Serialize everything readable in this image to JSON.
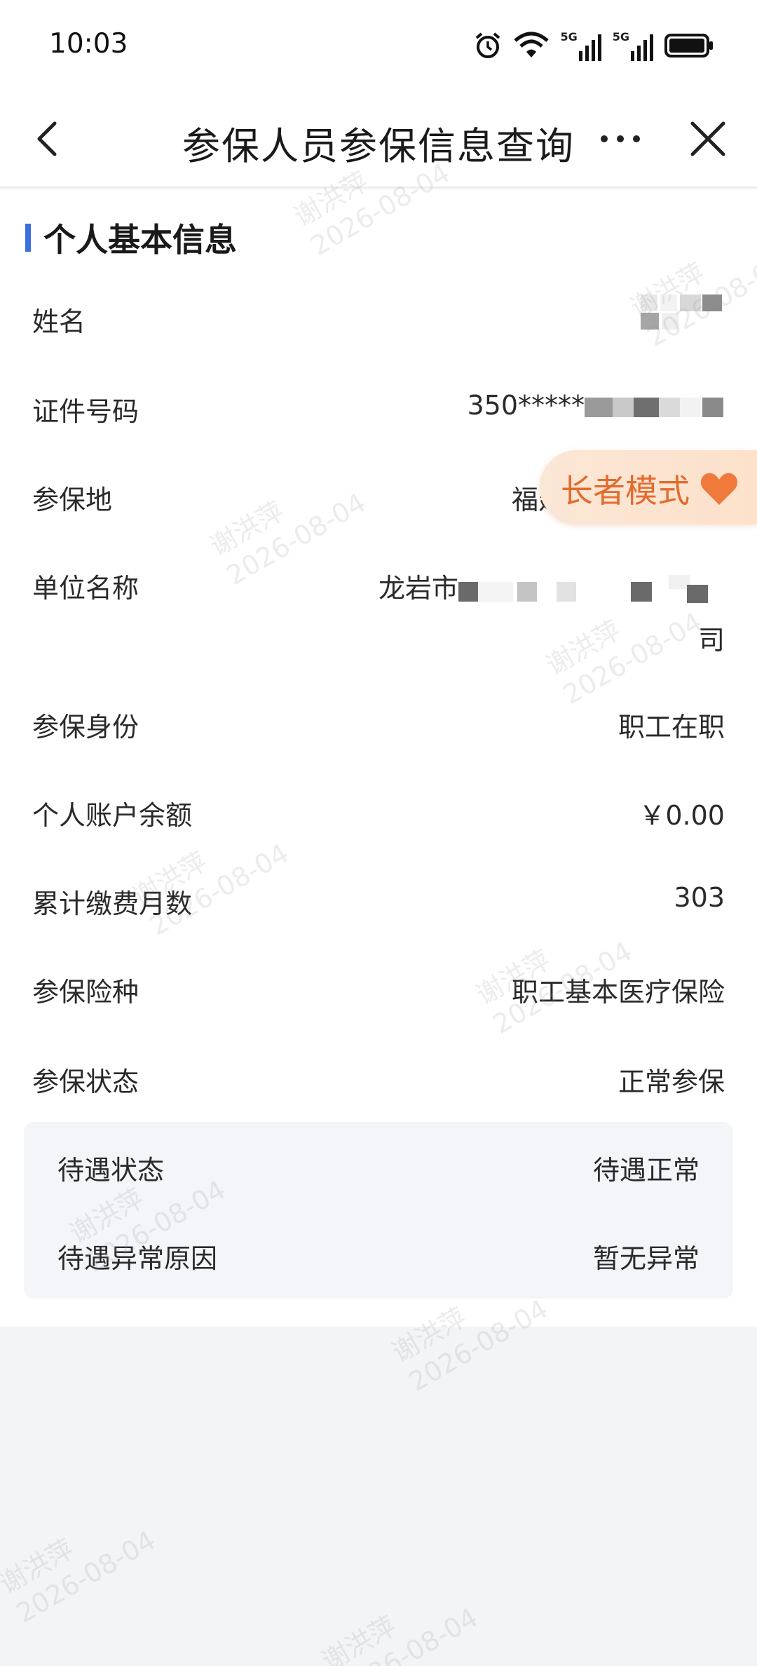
{
  "status_bar": {
    "time": "10:03",
    "signal_1": "5G",
    "signal_2": "5G"
  },
  "nav": {
    "title": "参保人员参保信息查询",
    "back_icon": "chevron-left-icon",
    "more_icon": "more-icon",
    "close_icon": "close-icon"
  },
  "section": {
    "title": "个人基本信息"
  },
  "fields": [
    {
      "label": "姓名",
      "value": ""
    },
    {
      "label": "证件号码",
      "value": "350*****"
    },
    {
      "label": "参保地",
      "value": "福建省龙岩市本级"
    },
    {
      "label": "单位名称",
      "value_start": "龙岩市",
      "value_end": "司"
    },
    {
      "label": "参保身份",
      "value": "职工在职"
    },
    {
      "label": "个人账户余额",
      "value": "￥0.00"
    },
    {
      "label": "累计缴费月数",
      "value": "303"
    },
    {
      "label": "参保险种",
      "value": "职工基本医疗保险"
    },
    {
      "label": "参保状态",
      "value": "正常参保"
    }
  ],
  "benefits": [
    {
      "label": "待遇状态",
      "value": "待遇正常"
    },
    {
      "label": "待遇异常原因",
      "value": "暂无异常"
    }
  ],
  "senior_mode": {
    "label": "长者模式",
    "heart_color": "#ef7a3c"
  },
  "watermark": {
    "name": "谢洪萍",
    "date": "2026-08-04"
  },
  "colors": {
    "accent": "#3b6fe0",
    "senior_text": "#e36b2e"
  }
}
